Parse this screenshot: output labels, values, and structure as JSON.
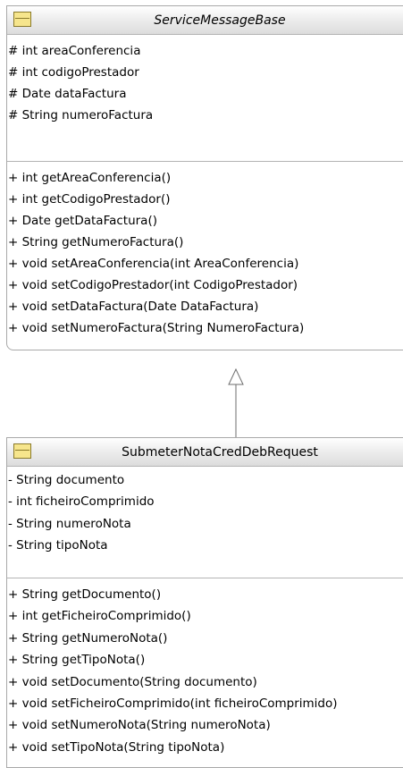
{
  "classes": [
    {
      "name": "ServiceMessageBase",
      "abstract": true,
      "attributes": [
        "# int areaConferencia",
        "# int codigoPrestador",
        "# Date dataFactura",
        "# String numeroFactura"
      ],
      "operations": [
        "+ int getAreaConferencia()",
        "+ int getCodigoPrestador()",
        "+ Date getDataFactura()",
        "+ String getNumeroFactura()",
        "+ void setAreaConferencia(int AreaConferencia)",
        "+ void setCodigoPrestador(int CodigoPrestador)",
        "+ void setDataFactura(Date DataFactura)",
        "+ void setNumeroFactura(String NumeroFactura)"
      ]
    },
    {
      "name": "SubmeterNotaCredDebRequest",
      "abstract": false,
      "attributes": [
        "- String documento",
        "- int ficheiroComprimido",
        "- String numeroNota",
        "- String tipoNota"
      ],
      "operations": [
        "+ String getDocumento()",
        "+ int getFicheiroComprimido()",
        "+ String getNumeroNota()",
        "+ String getTipoNota()",
        "+ void setDocumento(String documento)",
        "+ void setFicheiroComprimido(int ficheiroComprimido)",
        "+ void setNumeroNota(String numeroNota)",
        "+ void setTipoNota(String tipoNota)"
      ]
    }
  ],
  "relationships": [
    {
      "type": "generalization",
      "from": "SubmeterNotaCredDebRequest",
      "to": "ServiceMessageBase"
    }
  ],
  "colors": {
    "border": "#a9a9a9",
    "divider": "#b4b4b4",
    "icon_fill": "#f6e58c",
    "icon_stroke": "#8a7a2a",
    "connector": "#6e6e6e"
  }
}
